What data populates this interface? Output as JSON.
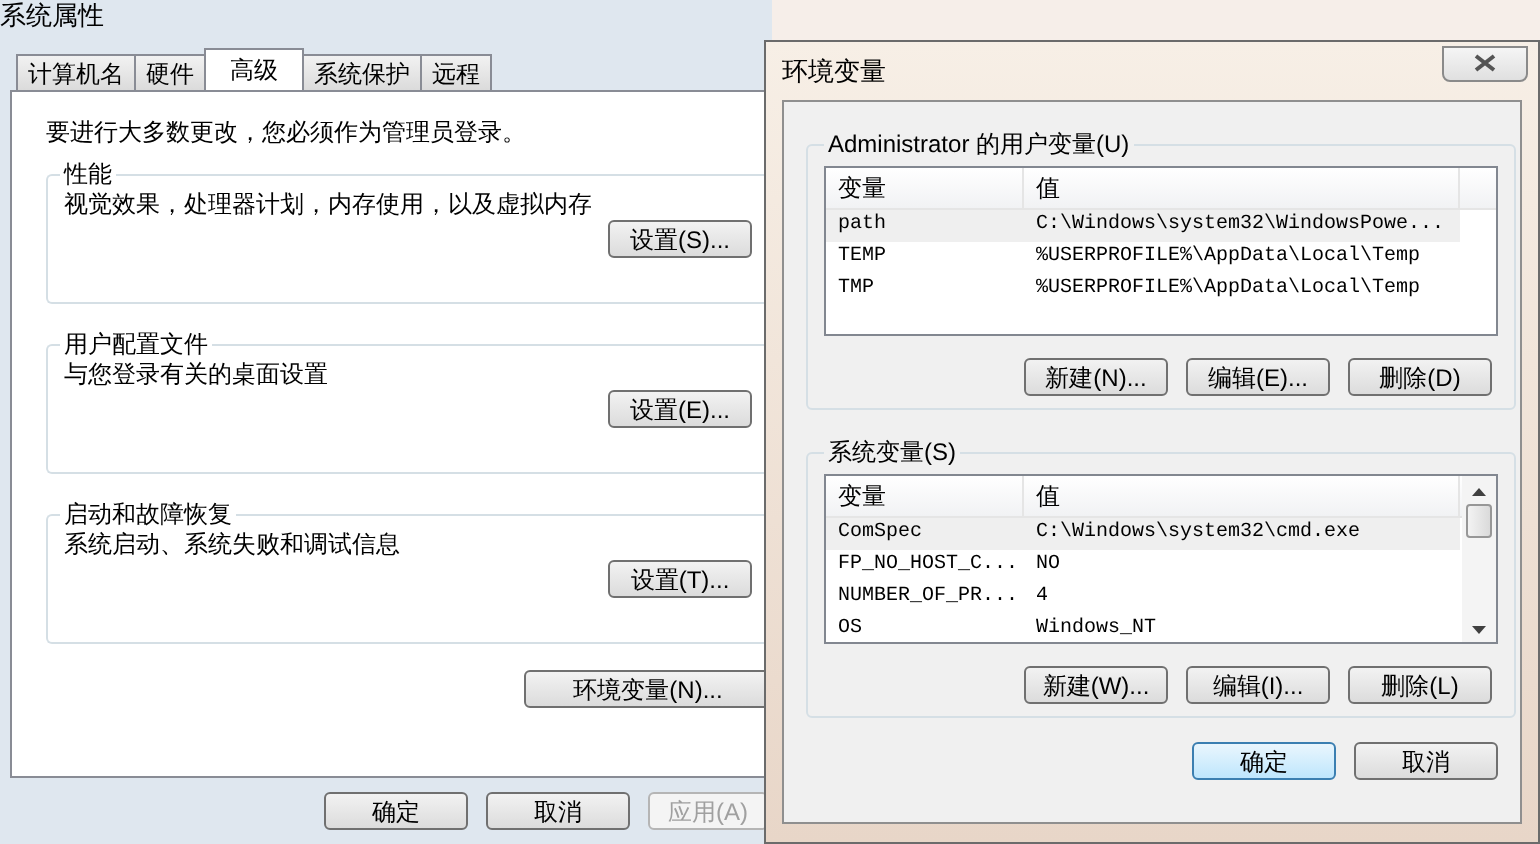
{
  "system_properties": {
    "title": "系统属性",
    "tabs": [
      {
        "label": "计算机名",
        "selected": false
      },
      {
        "label": "硬件",
        "selected": false
      },
      {
        "label": "高级",
        "selected": true
      },
      {
        "label": "系统保护",
        "selected": false
      },
      {
        "label": "远程",
        "selected": false
      }
    ],
    "admin_note": "要进行大多数更改，您必须作为管理员登录。",
    "groups": [
      {
        "title": "性能",
        "description": "视觉效果，处理器计划，内存使用，以及虚拟内存",
        "button": "设置(S)..."
      },
      {
        "title": "用户配置文件",
        "description": "与您登录有关的桌面设置",
        "button": "设置(E)..."
      },
      {
        "title": "启动和故障恢复",
        "description": "系统启动、系统失败和调试信息",
        "button": "设置(T)..."
      }
    ],
    "env_button": "环境变量(N)...",
    "buttons": [
      {
        "label": "确定",
        "disabled": false
      },
      {
        "label": "取消",
        "disabled": false
      },
      {
        "label": "应用(A)",
        "disabled": true
      }
    ]
  },
  "environment_variables": {
    "title": "环境变量",
    "lists": [
      {
        "title": "Administrator 的用户变量(U)",
        "columns": [
          "变量",
          "值"
        ],
        "scrollbar": false,
        "rows": [
          {
            "name": "path",
            "value": "C:\\Windows\\system32\\WindowsPowe...",
            "selected": true
          },
          {
            "name": "TEMP",
            "value": "%USERPROFILE%\\AppData\\Local\\Temp",
            "selected": false
          },
          {
            "name": "TMP",
            "value": "%USERPROFILE%\\AppData\\Local\\Temp",
            "selected": false
          }
        ],
        "buttons": [
          "新建(N)...",
          "编辑(E)...",
          "删除(D)"
        ]
      },
      {
        "title": "系统变量(S)",
        "columns": [
          "变量",
          "值"
        ],
        "scrollbar": true,
        "rows": [
          {
            "name": "ComSpec",
            "value": "C:\\Windows\\system32\\cmd.exe",
            "selected": true
          },
          {
            "name": "FP_NO_HOST_C...",
            "value": "NO",
            "selected": false
          },
          {
            "name": "NUMBER_OF_PR...",
            "value": "4",
            "selected": false
          },
          {
            "name": "OS",
            "value": "Windows_NT",
            "selected": false
          }
        ],
        "buttons": [
          "新建(W)...",
          "编辑(I)...",
          "删除(L)"
        ]
      }
    ],
    "buttons": [
      {
        "label": "确定",
        "default": true
      },
      {
        "label": "取消",
        "default": false
      }
    ]
  }
}
